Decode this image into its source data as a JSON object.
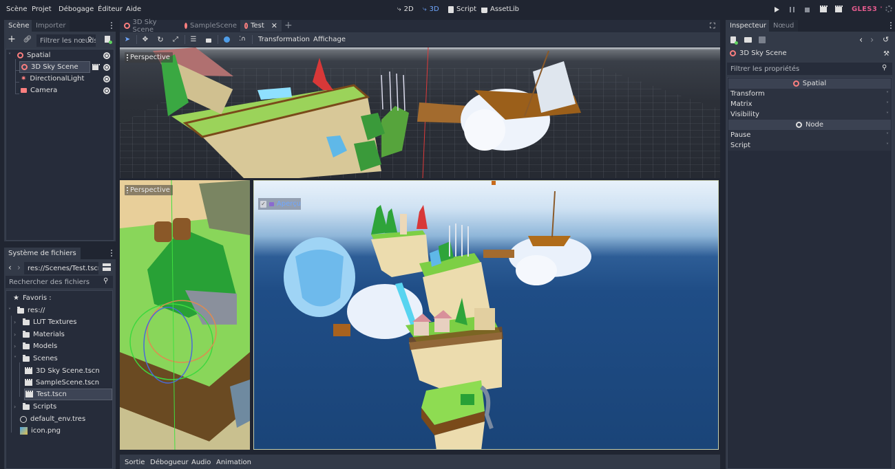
{
  "menubar": {
    "items": [
      "Scène",
      "Projet",
      "Débogage",
      "Éditeur",
      "Aide"
    ],
    "workspaces": [
      {
        "label": "2D",
        "icon": "2d-icon",
        "active": false
      },
      {
        "label": "3D",
        "icon": "3d-icon",
        "active": true
      },
      {
        "label": "Script",
        "icon": "script-icon",
        "active": false
      },
      {
        "label": "AssetLib",
        "icon": "assetlib-icon",
        "active": false
      }
    ],
    "renderer": "GLES3",
    "accent": "#e05a8c"
  },
  "scene_dock": {
    "tabs": [
      "Scène",
      "Importer"
    ],
    "filter_placeholder": "Filtrer les nœuds",
    "tree": [
      {
        "label": "Spatial",
        "icon": "spatial-icon",
        "depth": 0,
        "expanded": true
      },
      {
        "label": "3D Sky Scene",
        "icon": "spatial-icon",
        "depth": 1,
        "selected": true,
        "instanced": true
      },
      {
        "label": "DirectionalLight",
        "icon": "light-icon",
        "depth": 1
      },
      {
        "label": "Camera",
        "icon": "camera-icon",
        "depth": 1
      }
    ]
  },
  "filesystem_dock": {
    "tab": "Système de fichiers",
    "path": "res://Scenes/Test.tscn",
    "search_placeholder": "Rechercher des fichiers",
    "favorites_label": "Favoris :",
    "tree": [
      {
        "label": "res://",
        "type": "folder",
        "depth": 0,
        "expanded": true
      },
      {
        "label": "LUT Textures",
        "type": "folder",
        "depth": 1
      },
      {
        "label": "Materials",
        "type": "folder",
        "depth": 1
      },
      {
        "label": "Models",
        "type": "folder",
        "depth": 1
      },
      {
        "label": "Scenes",
        "type": "folder",
        "depth": 1,
        "expanded": true
      },
      {
        "label": "3D Sky Scene.tscn",
        "type": "scene",
        "depth": 2
      },
      {
        "label": "SampleScene.tscn",
        "type": "scene",
        "depth": 2
      },
      {
        "label": "Test.tscn",
        "type": "scene",
        "depth": 2,
        "selected": true
      },
      {
        "label": "Scripts",
        "type": "folder",
        "depth": 1
      },
      {
        "label": "default_env.tres",
        "type": "env",
        "depth": 1
      },
      {
        "label": "icon.png",
        "type": "image",
        "depth": 1
      }
    ]
  },
  "editor": {
    "scene_tabs": [
      {
        "label": "3D Sky Scene",
        "active": false
      },
      {
        "label": "SampleScene",
        "active": false
      },
      {
        "label": "Test",
        "active": true
      }
    ],
    "toolbar_menus": [
      "Transformation",
      "Affichage"
    ],
    "viewports": [
      {
        "label": "Perspective"
      },
      {
        "label": "Perspective"
      }
    ],
    "preview_label": "Aperçu"
  },
  "bottom_panel": {
    "tabs": [
      "Sortie",
      "Débogueur",
      "Audio",
      "Animation"
    ]
  },
  "inspector": {
    "tabs": [
      "Inspecteur",
      "Nœud"
    ],
    "node_name": "3D Sky Scene",
    "filter_placeholder": "Filtrer les propriétés",
    "sections": [
      {
        "title": "Spatial",
        "icon": "spatial-icon",
        "properties": [
          "Transform",
          "Matrix",
          "Visibility"
        ]
      },
      {
        "title": "Node",
        "icon": "node-icon",
        "properties": [
          "Pause",
          "Script"
        ]
      }
    ]
  }
}
